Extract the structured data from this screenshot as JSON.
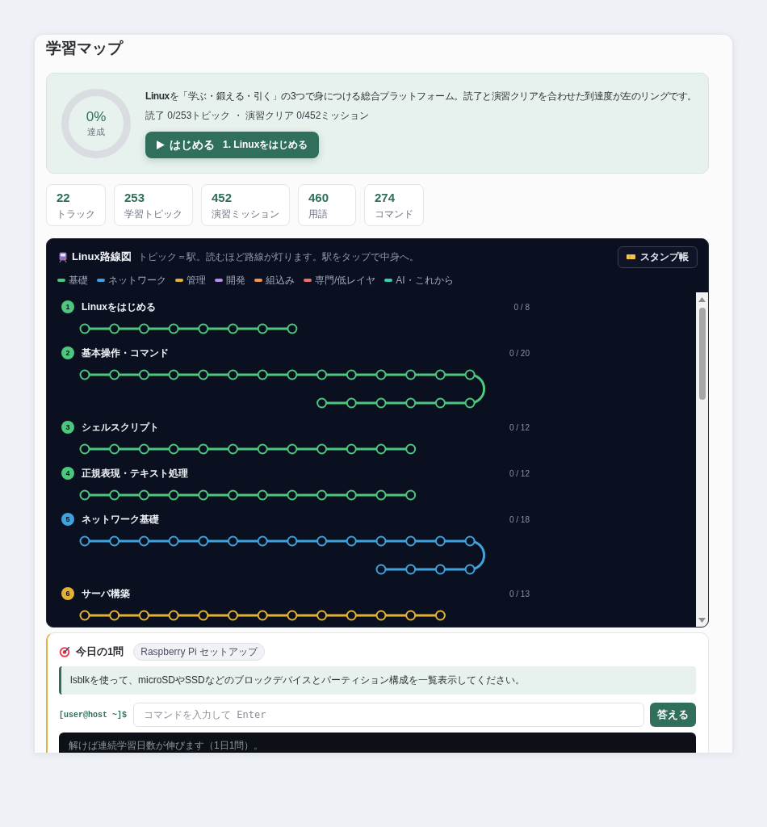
{
  "page": {
    "title": "学習マップ"
  },
  "progress": {
    "ring": {
      "level": 0,
      "value": "0%",
      "caption": "達成"
    },
    "description": "**Linux**を「学ぶ・鍛える・引く」の3つで身につける総合プラットフォーム。読了と演習クリアを合わせた到達度が左のリングです。",
    "stats_line": "読了 0/253トピック ・ 演習クリア 0/452ミッション",
    "start_button": {
      "label": "はじめる",
      "sublabel": "1. Linuxをはじめる"
    }
  },
  "stats": [
    {
      "value": "22",
      "label": "トラック"
    },
    {
      "value": "253",
      "label": "学習トピック"
    },
    {
      "value": "452",
      "label": "演習ミッション"
    },
    {
      "value": "460",
      "label": "用語"
    },
    {
      "value": "274",
      "label": "コマンド"
    }
  ],
  "route_map": {
    "title": "Linux路線図",
    "subtitle": "トピック＝駅。読むほど路線が灯ります。駅をタップで中身へ。",
    "stamp_button": "スタンプ帳",
    "legend": [
      {
        "label": "基礎",
        "color": "#4cc77e"
      },
      {
        "label": "ネットワーク",
        "color": "#3ea3dc"
      },
      {
        "label": "管理",
        "color": "#e3b234"
      },
      {
        "label": "開発",
        "color": "#b98cf0"
      },
      {
        "label": "組込み",
        "color": "#f0954a"
      },
      {
        "label": "専門/低レイヤ",
        "color": "#ee6f6f"
      },
      {
        "label": "AI・これから",
        "color": "#34d0ae"
      }
    ],
    "tracks": [
      {
        "number": "1",
        "title": "Linuxをはじめる",
        "count": "0 / 8",
        "color": "#4cc77e",
        "stations": [
          {
            "lit": false
          },
          {
            "lit": false
          },
          {
            "lit": false
          },
          {
            "lit": false
          },
          {
            "lit": false
          },
          {
            "lit": false
          },
          {
            "lit": false
          },
          {
            "lit": false
          }
        ]
      },
      {
        "number": "2",
        "title": "基本操作・コマンド",
        "count": "0 / 20",
        "color": "#4cc77e",
        "stations": [
          {
            "lit": false
          },
          {
            "lit": false
          },
          {
            "lit": false
          },
          {
            "lit": false
          },
          {
            "lit": false
          },
          {
            "lit": false
          },
          {
            "lit": false
          },
          {
            "lit": false
          },
          {
            "lit": false
          },
          {
            "lit": false
          },
          {
            "lit": false
          },
          {
            "lit": false
          },
          {
            "lit": false
          },
          {
            "lit": false
          },
          {
            "lit": false
          },
          {
            "lit": false
          },
          {
            "lit": false
          },
          {
            "lit": false
          },
          {
            "lit": false
          },
          {
            "lit": false
          }
        ]
      },
      {
        "number": "3",
        "title": "シェルスクリプト",
        "count": "0 / 12",
        "color": "#4cc77e",
        "stations": [
          {
            "lit": false
          },
          {
            "lit": false
          },
          {
            "lit": false
          },
          {
            "lit": false
          },
          {
            "lit": false
          },
          {
            "lit": false
          },
          {
            "lit": false
          },
          {
            "lit": false
          },
          {
            "lit": false
          },
          {
            "lit": false
          },
          {
            "lit": false
          },
          {
            "lit": false
          }
        ]
      },
      {
        "number": "4",
        "title": "正規表現・テキスト処理",
        "count": "0 / 12",
        "color": "#4cc77e",
        "stations": [
          {
            "lit": false
          },
          {
            "lit": false
          },
          {
            "lit": false
          },
          {
            "lit": false
          },
          {
            "lit": false
          },
          {
            "lit": false
          },
          {
            "lit": false
          },
          {
            "lit": false
          },
          {
            "lit": false
          },
          {
            "lit": false
          },
          {
            "lit": false
          },
          {
            "lit": false
          }
        ]
      },
      {
        "number": "5",
        "title": "ネットワーク基礎",
        "count": "0 / 18",
        "color": "#3ea3dc",
        "stations": [
          {
            "lit": false
          },
          {
            "lit": false
          },
          {
            "lit": false
          },
          {
            "lit": false
          },
          {
            "lit": false
          },
          {
            "lit": false
          },
          {
            "lit": false
          },
          {
            "lit": false
          },
          {
            "lit": false
          },
          {
            "lit": false
          },
          {
            "lit": false
          },
          {
            "lit": false
          },
          {
            "lit": false
          },
          {
            "lit": false
          },
          {
            "lit": false
          },
          {
            "lit": false
          },
          {
            "lit": false
          },
          {
            "lit": false
          }
        ]
      },
      {
        "number": "6",
        "title": "サーバ構築",
        "count": "0 / 13",
        "color": "#e3b234",
        "stations": [
          {
            "lit": false
          },
          {
            "lit": false
          },
          {
            "lit": false
          },
          {
            "lit": false
          },
          {
            "lit": false
          },
          {
            "lit": false
          },
          {
            "lit": false
          },
          {
            "lit": false
          },
          {
            "lit": false
          },
          {
            "lit": false
          },
          {
            "lit": false
          },
          {
            "lit": false
          },
          {
            "lit": false
          }
        ]
      }
    ]
  },
  "daily": {
    "title": "今日の1問",
    "tag": "Raspberry Pi セットアップ",
    "question": "lsblkを使って、microSDやSSDなどのブロックデバイスとパーティション構成を一覧表示してください。",
    "prompt": "[user@host ~]$",
    "input": {
      "placeholder": "コマンドを入力して Enter"
    },
    "answer_button": "答える",
    "terminal": "解けば連続学習日数が伸びます（1日1問）。"
  }
}
